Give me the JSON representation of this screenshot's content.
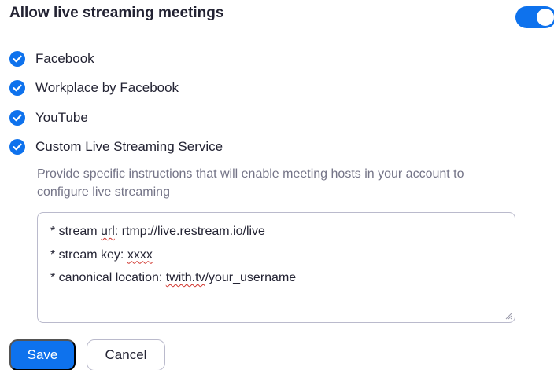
{
  "setting": {
    "title": "Allow live streaming meetings",
    "toggle_on": true
  },
  "options": [
    {
      "label": "Facebook",
      "checked": true
    },
    {
      "label": "Workplace by Facebook",
      "checked": true
    },
    {
      "label": "YouTube",
      "checked": true
    },
    {
      "label": "Custom Live Streaming Service",
      "checked": true
    }
  ],
  "custom": {
    "description": "Provide specific instructions that will enable meeting hosts in your account to configure live streaming",
    "instructions": {
      "line1_a": "* stream ",
      "line1_b": "url",
      "line1_c": ": rtmp://live.restream.io/live",
      "line2_a": "* stream key: ",
      "line2_b": "xxxx",
      "line3_a": "* canonical location: ",
      "line3_b": "twith.tv",
      "line3_c": "/your_username"
    }
  },
  "actions": {
    "save_label": "Save",
    "cancel_label": "Cancel"
  },
  "colors": {
    "accent": "#0e72ed",
    "text": "#232333",
    "muted": "#747487",
    "border": "#babacc",
    "spellcheck": "#d0342c"
  }
}
